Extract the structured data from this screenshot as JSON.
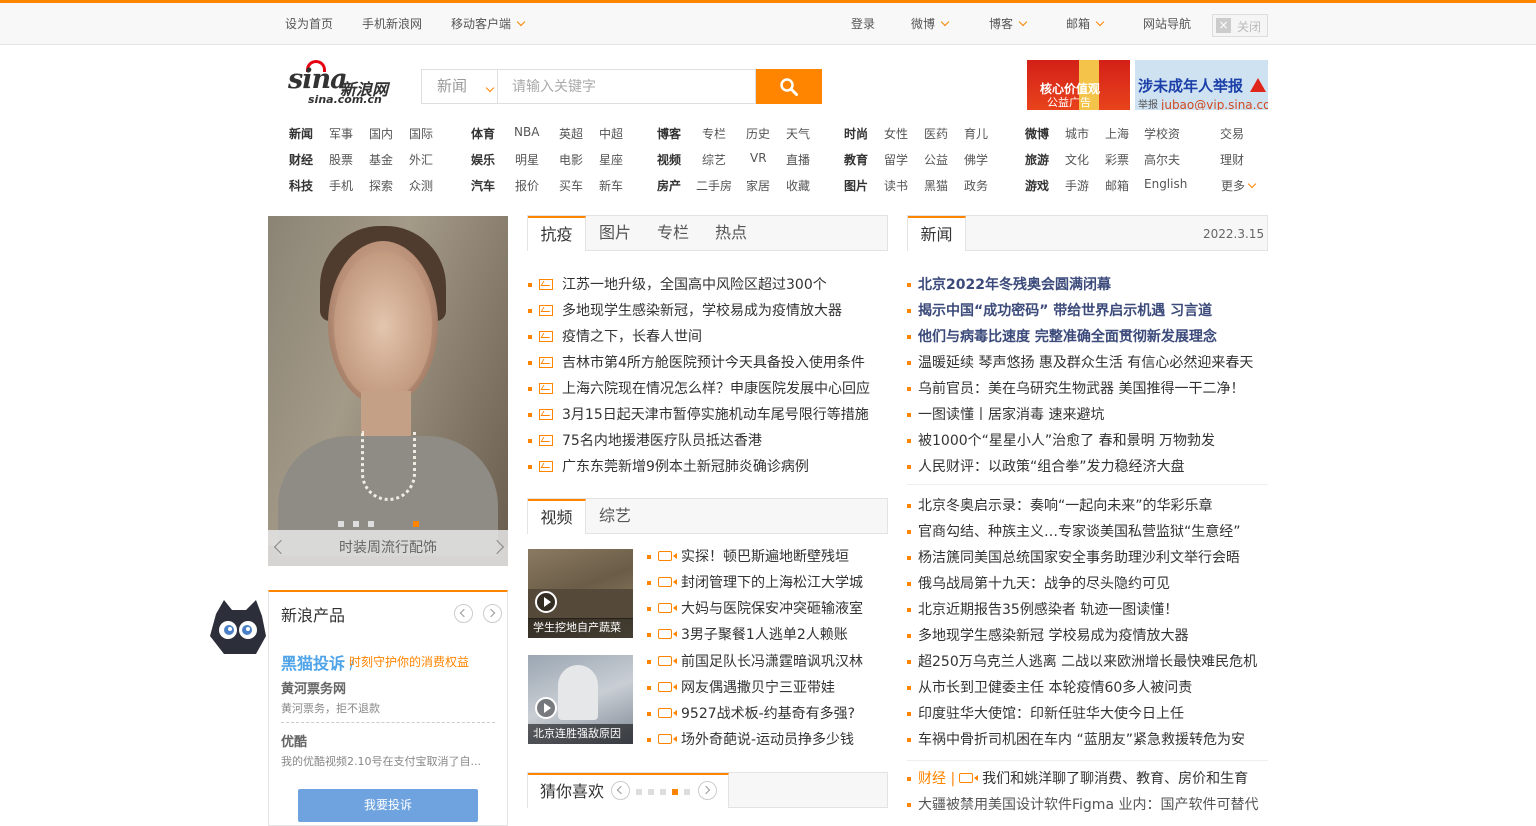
{
  "topbar": {
    "left": [
      "设为首页",
      "手机新浪网",
      "移动客户端"
    ],
    "right": [
      "登录",
      "微博",
      "博客",
      "邮箱",
      "网站导航"
    ],
    "close_label": "关闭"
  },
  "logo": {
    "text": "sina",
    "cn": "新浪网",
    "domain": "sina.com.cn"
  },
  "search": {
    "category": "新闻",
    "placeholder": "请输入关键字"
  },
  "ads": {
    "ad1_line1": "核心价值观",
    "ad1_line2": "公益广告",
    "ad2_title": "涉未成年人举报",
    "ad2_small": "举报",
    "ad2_email": "jubao@vip.sina.com"
  },
  "nav": [
    [
      [
        "新闻",
        "军事",
        "国内",
        "国际"
      ],
      [
        "财经",
        "股票",
        "基金",
        "外汇"
      ],
      [
        "科技",
        "手机",
        "探索",
        "众测"
      ]
    ],
    [
      [
        "体育",
        "NBA",
        "英超",
        "中超"
      ],
      [
        "娱乐",
        "明星",
        "电影",
        "星座"
      ],
      [
        "汽车",
        "报价",
        "买车",
        "新车"
      ]
    ],
    [
      [
        "博客",
        "专栏",
        "历史",
        "天气"
      ],
      [
        "视频",
        "综艺",
        "VR",
        "直播"
      ],
      [
        "房产",
        "二手房",
        "家居",
        "收藏"
      ]
    ],
    [
      [
        "时尚",
        "女性",
        "医药",
        "育儿"
      ],
      [
        "教育",
        "留学",
        "公益",
        "佛学"
      ],
      [
        "图片",
        "读书",
        "黑猫",
        "政务"
      ]
    ],
    [
      [
        "微博",
        "城市",
        "上海",
        "学校资"
      ],
      [
        "旅游",
        "文化",
        "彩票",
        "高尔夫"
      ],
      [
        "游戏",
        "手游",
        "邮箱",
        "English"
      ]
    ],
    [
      "交易",
      "理财",
      "更多"
    ]
  ],
  "slideshow": {
    "caption": "时装周流行配饰"
  },
  "products": {
    "title": "新浪产品",
    "brand": "黑猫投诉",
    "slogan": "时刻守护你的消费权益",
    "items": [
      {
        "name": "黄河票务网",
        "desc": "黄河票务，拒不退款"
      },
      {
        "name": "优酷",
        "desc": "我的优酷视频2.10号在支付宝取消了自..."
      }
    ],
    "button": "我要投诉"
  },
  "mid_tabs": [
    "抗疫",
    "图片",
    "专栏",
    "热点"
  ],
  "mid_news": [
    "江苏一地升级，全国高中风险区超过300个",
    "多地现学生感染新冠，学校易成为疫情放大器",
    "疫情之下，长春人世间",
    "吉林市第4所方舱医院预计今天具备投入使用条件",
    "上海六院现在情况怎么样？申康医院发展中心回应",
    "3月15日起天津市暂停实施机动车尾号限行等措施",
    "75名内地援港医疗队员抵达香港",
    "广东东莞新增9例本土新冠肺炎确诊病例"
  ],
  "video_tabs": [
    "视频",
    "综艺"
  ],
  "video_thumbs": [
    "学生挖地自产蔬菜",
    "北京连胜强敌原因"
  ],
  "video_news": [
    "实探！顿巴斯遍地断壁残垣",
    "封闭管理下的上海松江大学城",
    "大妈与医院保安冲突砸输液室",
    "3男子聚餐1人逃单2人赖账",
    "前国足队长冯潇霆暗讽巩汉林",
    "网友偶遇撒贝宁三亚带娃",
    "9527战术板-约基奇有多强?",
    "场外奇葩说-运动员挣多少钱"
  ],
  "guess": {
    "title": "猜你喜欢"
  },
  "right": {
    "tab": "新闻",
    "date": "2022.3.15",
    "headlines": [
      "北京2022年冬残奥会圆满闭幕",
      "揭示中国“成功密码” 带给世界启示机遇 习言道",
      "他们与病毒比速度 完整准确全面贯彻新发展理念"
    ],
    "news1": [
      "温暖延续 琴声悠扬 惠及群众生活 有信心必然迎来春天",
      "乌前官员：美在乌研究生物武器 美国推得一干二净！",
      "一图读懂丨居家消毒 速来避坑",
      "被1000个“星星小人”治愈了 春和景明 万物勃发",
      "人民财评：以政策“组合拳”发力稳经济大盘"
    ],
    "news2": [
      "北京冬奥启示录：奏响“一起向未来”的华彩乐章",
      "官商勾结、种族主义…专家谈美国私营监狱“生意经”",
      "杨洁篪同美国总统国家安全事务助理沙利文举行会晤",
      "俄乌战局第十九天：战争的尽头隐约可见",
      "北京近期报告35例感染者 轨迹一图读懂！",
      "多地现学生感染新冠 学校易成为疫情放大器",
      "超250万乌克兰人逃离 二战以来欧洲增长最快难民危机",
      "从市长到卫健委主任 本轮疫情60多人被问责",
      "印度驻华大使馆：印新任驻华大使今日上任",
      "车祸中骨折司机困在车内 “蓝朋友”紧急救援转危为安"
    ],
    "finance_label": "财经 |",
    "finance_news": "我们和姚洋聊了聊消费、教育、房价和生育",
    "finance_news2": "大疆被禁用美国设计软件Figma 业内：国产软件可替代"
  }
}
